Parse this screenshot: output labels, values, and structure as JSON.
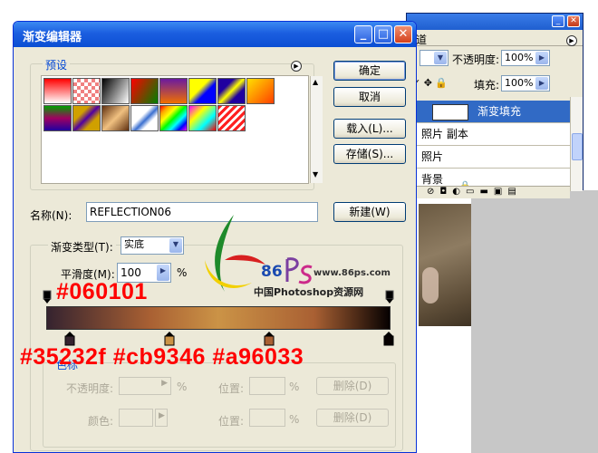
{
  "layers_panel": {
    "tab_label": "道",
    "opacity_label": "不透明度:",
    "opacity_value": "100%",
    "fill_label": "填充:",
    "fill_value": "100%",
    "layers": [
      {
        "name": "渐变填充",
        "selected": true
      },
      {
        "name": "照片 副本",
        "selected": false
      },
      {
        "name": "照片",
        "selected": false
      },
      {
        "name": "背景",
        "selected": false
      }
    ]
  },
  "dialog": {
    "title": "渐变编辑器",
    "presets_label": "预设",
    "ok_label": "确定",
    "cancel_label": "取消",
    "load_label": "载入(L)...",
    "save_label": "存储(S)...",
    "name_label": "名称(N):",
    "name_value": "REFLECTION06",
    "new_label": "新建(W)",
    "gradient_type_label": "渐变类型(T):",
    "gradient_type_value": "实底",
    "smoothness_label": "平滑度(M):",
    "smoothness_value": "100",
    "smoothness_unit": "%",
    "stops_group_label": "色标",
    "opacity_label": "不透明度:",
    "opacity_unit": "%",
    "location_label": "位置:",
    "location_unit": "%",
    "delete_label": "删除(D)",
    "color_label": "颜色:",
    "location2_label": "位置:",
    "location2_unit": "%",
    "delete2_label": "删除(D)"
  },
  "presets": [
    {
      "colors": "#ff0000,#ffffff"
    },
    {
      "colors": "checker-red"
    },
    {
      "colors": "#000000,#ffffff"
    },
    {
      "colors": "#ff0000,#00a000"
    },
    {
      "colors": "#7a1aa0,#f07000"
    },
    {
      "colors": "#ffff00,#0000ff"
    },
    {
      "colors": "#ffff00,#2000a0"
    },
    {
      "colors": "#ffe000,#ff4000"
    },
    {
      "colors": "#00a000,#a00060"
    },
    {
      "colors": "#d0a000,#5000a0"
    },
    {
      "colors": "#f0c080,#603010"
    },
    {
      "colors": "#ffffff,#3a6fd0"
    },
    {
      "colors": "rainbow"
    },
    {
      "colors": "rainbow2"
    },
    {
      "colors": "stripes"
    }
  ],
  "overlay": {
    "stop_color_top_right": "#060101",
    "stop_colors_bottom": "#35232f #cb9346 #a96033",
    "watermark_number": "86",
    "watermark_url": "www.86ps.com",
    "watermark_cn": "中国Photoshop资源网"
  },
  "colors": {
    "accent": "#316ac5",
    "title_blue": "#0b4fd3",
    "stop1": "#35232f",
    "stop2": "#cb9346",
    "stop3": "#a96033",
    "stop4": "#060101"
  }
}
